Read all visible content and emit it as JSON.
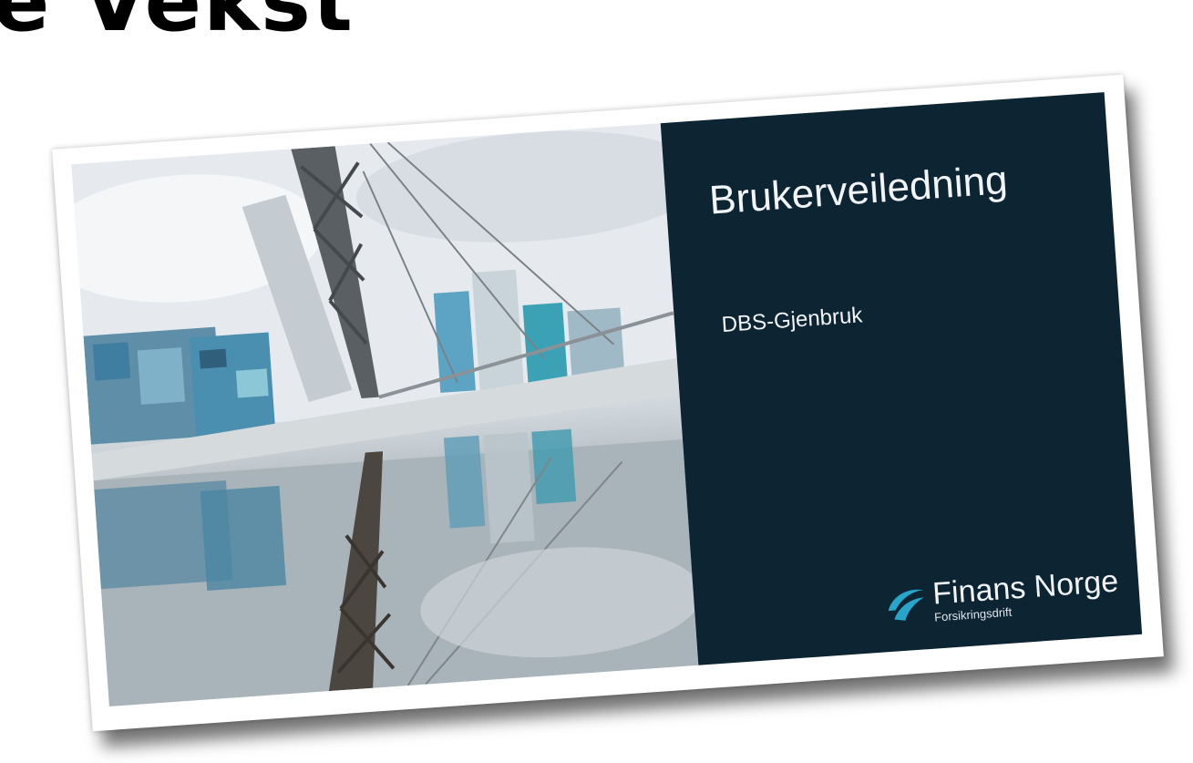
{
  "page": {
    "top_heading": "e Vekst"
  },
  "slide": {
    "title": "Brukerveiledning",
    "subtitle": "DBS-Gjenbruk",
    "logo": {
      "name": "Finans Norge",
      "sub": "Forsikringsdrift",
      "icon": "finans-norge-logo-mark"
    },
    "photo_description_icon": "bridge-photo",
    "colors": {
      "panel": "#0d2433",
      "logo_accent": "#27a6c9",
      "text": "#f2f5f7"
    }
  }
}
